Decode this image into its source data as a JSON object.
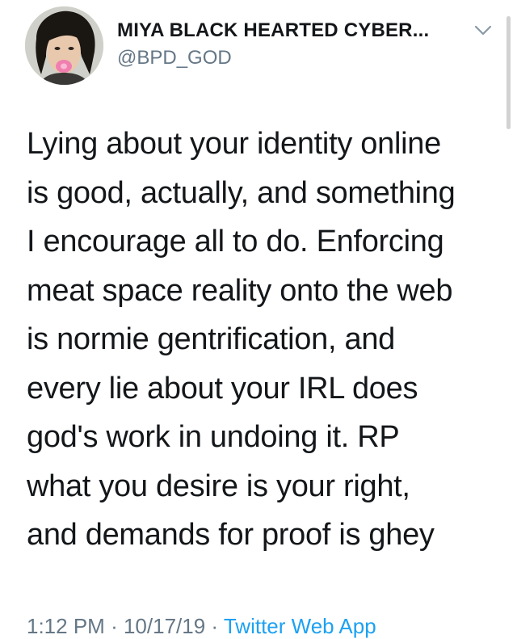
{
  "author": {
    "display_name": "MIYA BLACK HEARTED CYBER...",
    "handle": "@BPD_GOD",
    "avatar_icon": "profile-photo",
    "more_icon": "chevron-down-icon"
  },
  "tweet": {
    "lines": [
      "Lying about your identity online",
      "is good, actually, and something",
      "I encourage all to do. Enforcing",
      "meat space reality onto the web",
      "is normie gentrification, and",
      "every lie about your IRL does",
      "god's work in undoing it. RP",
      "what you desire is your right,",
      "and demands for proof is ghey"
    ]
  },
  "meta": {
    "time": "1:12 PM",
    "separator": "·",
    "date": "10/17/19",
    "source": "Twitter Web App"
  },
  "colors": {
    "text": "#14171a",
    "secondary": "#657786",
    "link": "#1da1f2"
  }
}
